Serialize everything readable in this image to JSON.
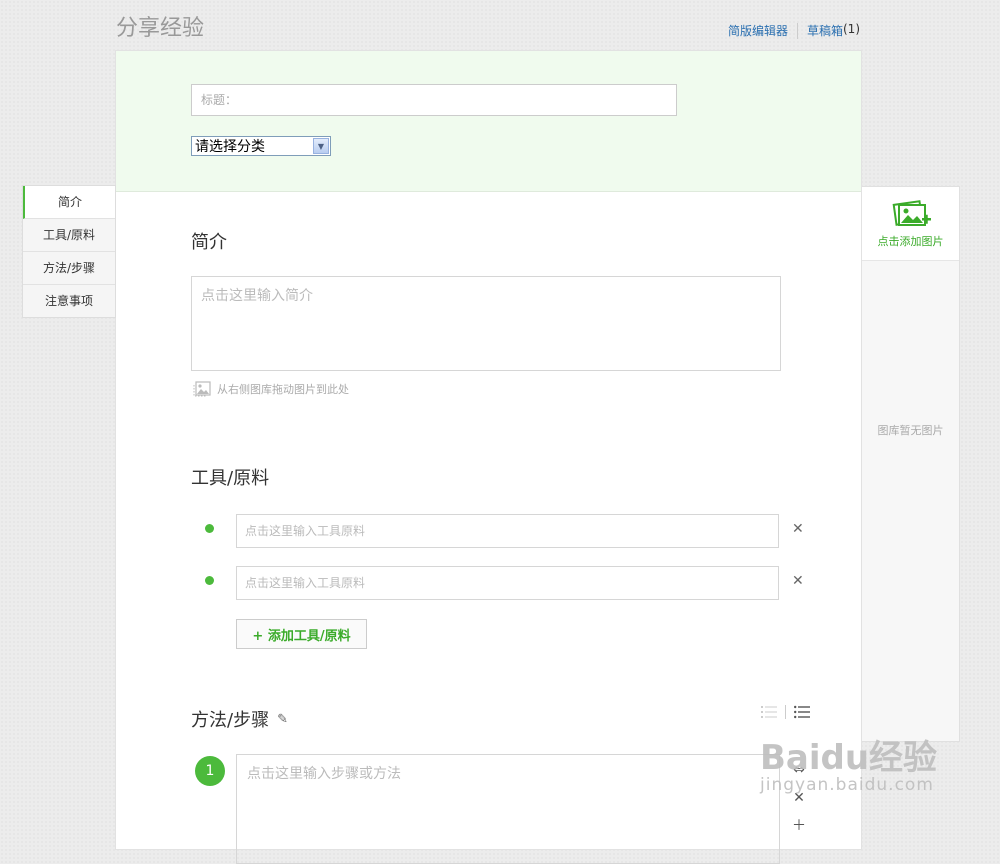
{
  "header": {
    "title": "分享经验",
    "simple_editor": "简版编辑器",
    "drafts": "草稿箱",
    "draft_count": "(1)"
  },
  "form": {
    "title_placeholder": "标题：",
    "category_selected": "请选择分类"
  },
  "sections": {
    "intro": {
      "heading": "简介",
      "placeholder": "点击这里输入简介",
      "drag_hint": "从右侧图库拖动图片到此处"
    },
    "tools": {
      "heading": "工具/原料",
      "items": [
        {
          "placeholder": "点击这里输入工具原料"
        },
        {
          "placeholder": "点击这里输入工具原料"
        }
      ],
      "add_button": "+ 添加工具/原料"
    },
    "steps": {
      "heading": "方法/步骤",
      "first_number": "1",
      "placeholder": "点击这里输入步骤或方法"
    }
  },
  "left_nav": {
    "items": [
      "简介",
      "工具/原料",
      "方法/步骤",
      "注意事项"
    ],
    "active_index": 0
  },
  "right_panel": {
    "add_image_label": "点击添加图片",
    "empty_text": "图库暂无图片"
  },
  "watermark": {
    "main": "Baidu经验",
    "sub": "jingyan.baidu.com"
  },
  "colors": {
    "accent_green": "#4cba3c",
    "link_blue": "#2a6fb0",
    "header_bg": "#f0fbee"
  }
}
